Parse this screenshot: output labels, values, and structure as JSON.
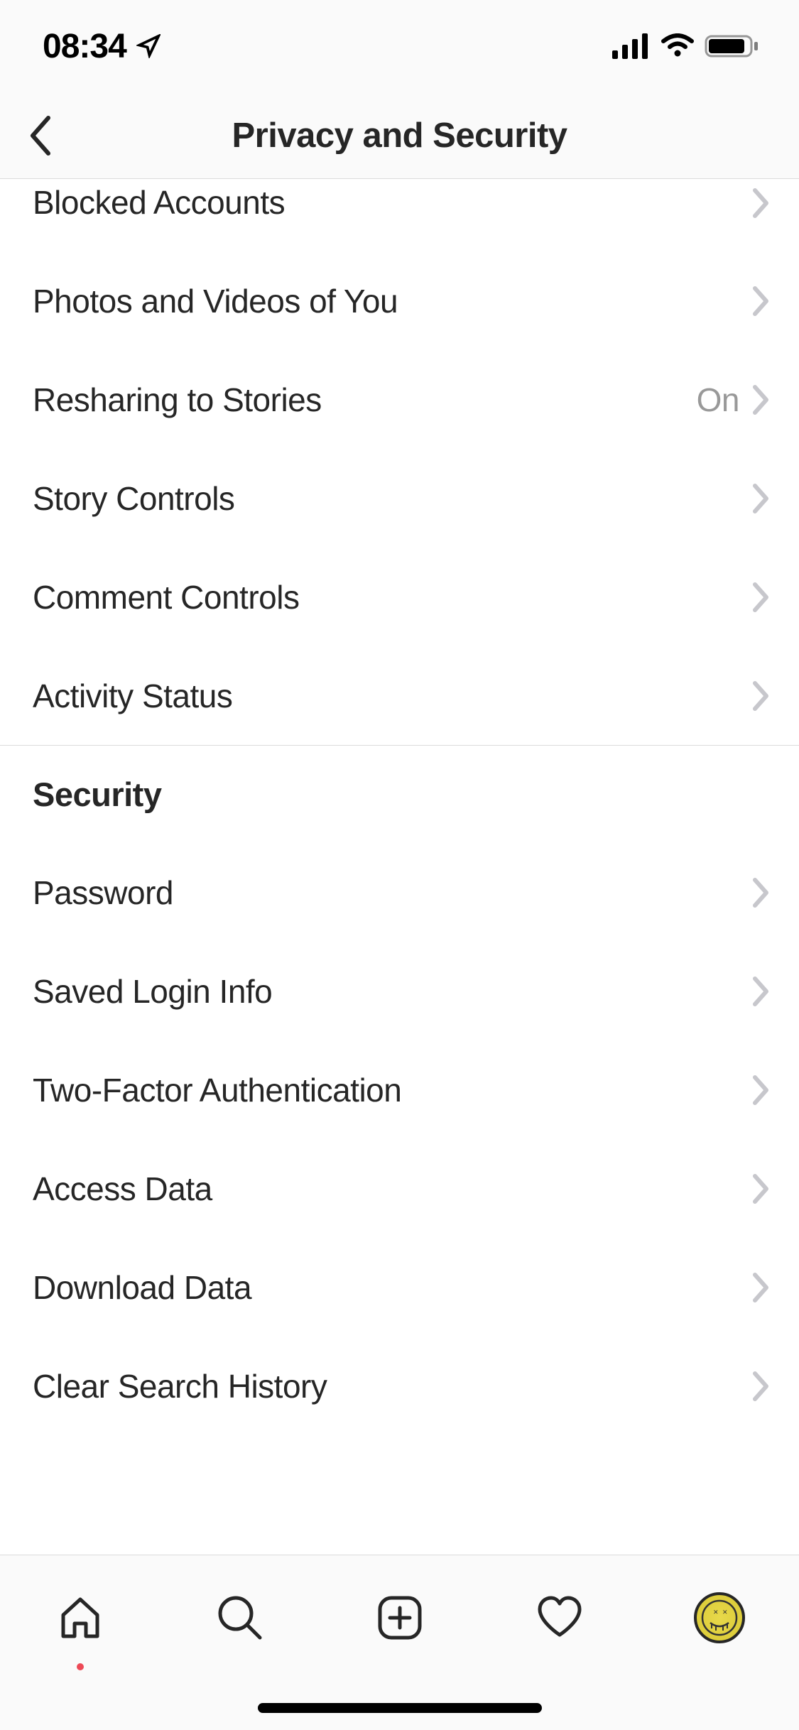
{
  "statusBar": {
    "time": "08:34"
  },
  "header": {
    "title": "Privacy and Security"
  },
  "rows": [
    {
      "id": "blocked-accounts",
      "label": "Blocked Accounts",
      "value": ""
    },
    {
      "id": "photos-videos-of-you",
      "label": "Photos and Videos of You",
      "value": ""
    },
    {
      "id": "resharing-to-stories",
      "label": "Resharing to Stories",
      "value": "On"
    },
    {
      "id": "story-controls",
      "label": "Story Controls",
      "value": ""
    },
    {
      "id": "comment-controls",
      "label": "Comment Controls",
      "value": ""
    },
    {
      "id": "activity-status",
      "label": "Activity Status",
      "value": ""
    }
  ],
  "section": {
    "title": "Security"
  },
  "securityRows": [
    {
      "id": "password",
      "label": "Password",
      "value": ""
    },
    {
      "id": "saved-login-info",
      "label": "Saved Login Info",
      "value": ""
    },
    {
      "id": "two-factor-auth",
      "label": "Two-Factor Authentication",
      "value": ""
    },
    {
      "id": "access-data",
      "label": "Access Data",
      "value": ""
    },
    {
      "id": "download-data",
      "label": "Download Data",
      "value": ""
    },
    {
      "id": "clear-search-history",
      "label": "Clear Search History",
      "value": ""
    }
  ]
}
